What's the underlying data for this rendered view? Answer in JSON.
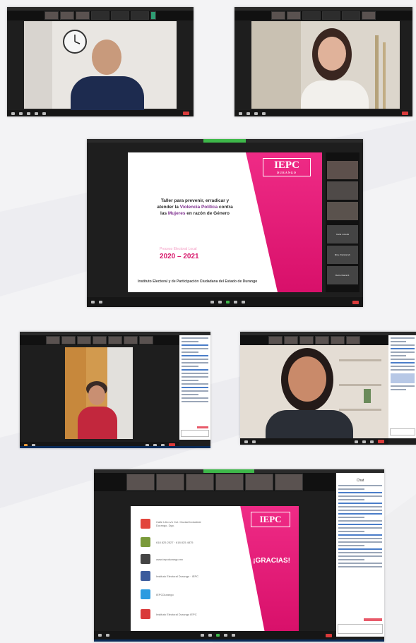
{
  "slide_main": {
    "title_l1": "Taller para prevenir, erradicar y",
    "title_l2a": "atender la ",
    "title_l2b": "Violencia Política",
    "title_l2c": " contra",
    "title_l3a": "las ",
    "title_l3b": "Mujeres",
    "title_l3c": " en razón de Género",
    "process_label": "Proceso Electoral Local",
    "years": "2020 – 2021",
    "institute": "Instituto Electoral y de Participación Ciudadana del Estado de Durango",
    "logo_text": "IEPC",
    "logo_sub": "DURANGO"
  },
  "side_tiles": [
    "Karla L Arellá",
    "Mtra. Patricia Mi.",
    "Rocío Ibarra R."
  ],
  "slide_final": {
    "gracias": "¡GRACIAS!",
    "logo_text": "IEPC",
    "contacts": [
      {
        "icon": "map-pin-icon",
        "color": "#e2453c",
        "text": "Calle Litio s/n Col. Ciudad Industrial Durango, Dgo."
      },
      {
        "icon": "phone-icon",
        "color": "#7a9a3a",
        "text": "618 825 2527 · 618 825 4875"
      },
      {
        "icon": "web-icon",
        "color": "#444444",
        "text": "www.iepcdurango.mx"
      },
      {
        "icon": "facebook-icon",
        "color": "#3b5b9c",
        "text": "Instituto Electoral Durango · IEPC"
      },
      {
        "icon": "twitter-icon",
        "color": "#2a9be0",
        "text": "IEPCDurango"
      },
      {
        "icon": "youtube-icon",
        "color": "#d93a3a",
        "text": "Instituto Electoral Durango IEPC"
      }
    ]
  },
  "chat": {
    "title": "Chat"
  },
  "colors": {
    "magenta": "#e81f7b",
    "end_button": "#d93a3a"
  }
}
